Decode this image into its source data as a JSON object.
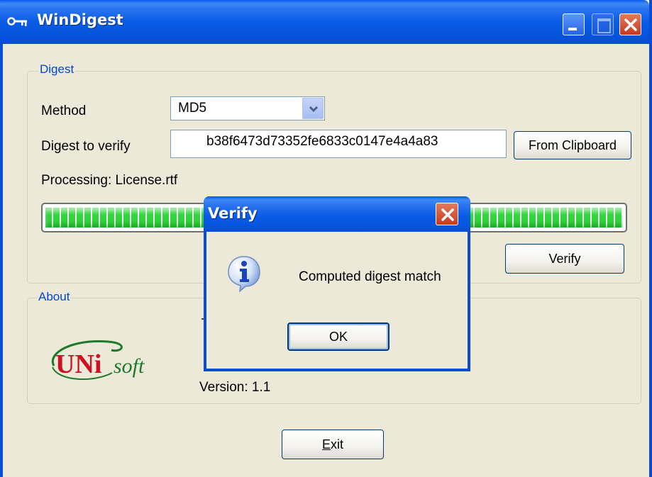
{
  "window": {
    "title": "WinDigest"
  },
  "digest": {
    "legend": "Digest",
    "method_label": "Method",
    "method_value": "MD5",
    "verify_label": "Digest to verify",
    "verify_value": "b38f6473d73352fe6833c0147e4a4a83",
    "clipboard_button": "From Clipboard",
    "processing_text": "Processing: License.rtf",
    "progress": 1.0,
    "verify_button": "Verify"
  },
  "about": {
    "legend": "About",
    "logo_uni": "UNi",
    "logo_soft": "soft",
    "version_text": "Version: 1.1"
  },
  "footer": {
    "exit_button_underlined": "E",
    "exit_button_rest": "xit"
  },
  "dialog": {
    "title": "Verify",
    "message": "Computed digest match",
    "ok_button": "OK",
    "icon": "info-icon"
  },
  "colors": {
    "titlebar": "#0a5ce6",
    "progress_fill": "#2fd53a",
    "group_legend": "#0046d5",
    "logo_red": "#cc1122",
    "logo_green": "#1c7a2a"
  }
}
